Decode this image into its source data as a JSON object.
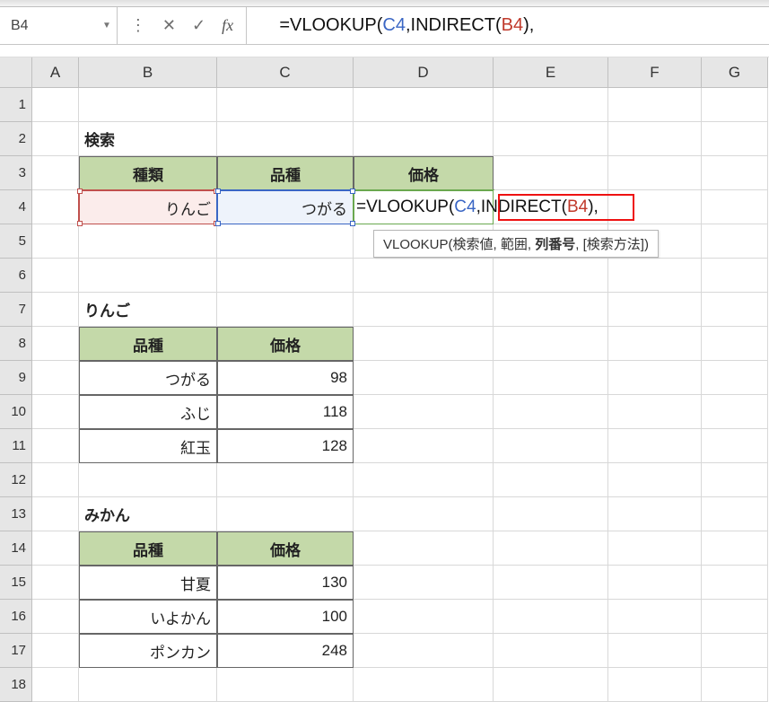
{
  "formula_bar": {
    "name_box": "B4",
    "dots": "⋮",
    "cancel": "✕",
    "confirm": "✓",
    "fx": "fx",
    "formula_prefix": "=VLOOKUP(",
    "ref1": "C4",
    "formula_mid1": ",INDIRECT(",
    "ref2": "B4",
    "formula_tail": "),"
  },
  "cols": [
    "A",
    "B",
    "C",
    "D",
    "E",
    "F",
    "G"
  ],
  "rows": [
    "1",
    "2",
    "3",
    "4",
    "5",
    "6",
    "7",
    "8",
    "9",
    "10",
    "11",
    "12",
    "13",
    "14",
    "15",
    "16",
    "17",
    "18"
  ],
  "search": {
    "title": "検索",
    "hdr_type": "種類",
    "hdr_variety": "品種",
    "hdr_price": "価格",
    "val_type": "りんご",
    "val_variety": "つがる"
  },
  "d4_formula": {
    "prefix": "=VLOOKUP(",
    "ref1": "C4",
    "comma1": ",",
    "indirect": "INDIRECT(",
    "ref2": "B4",
    "close_indirect_comma": "),"
  },
  "tooltip": {
    "fn": "VLOOKUP",
    "open": "(",
    "arg1": "検索値",
    "arg2": "範囲",
    "arg3": "列番号",
    "arg4": "[検索方法]",
    "close": ")"
  },
  "table_apple": {
    "title": "りんご",
    "hdr1": "品種",
    "hdr2": "価格",
    "rows": [
      {
        "name": "つがる",
        "price": "98"
      },
      {
        "name": "ふじ",
        "price": "118"
      },
      {
        "name": "紅玉",
        "price": "128"
      }
    ]
  },
  "table_orange": {
    "title": "みかん",
    "hdr1": "品種",
    "hdr2": "価格",
    "rows": [
      {
        "name": "甘夏",
        "price": "130"
      },
      {
        "name": "いよかん",
        "price": "100"
      },
      {
        "name": "ポンカン",
        "price": "248"
      }
    ]
  }
}
